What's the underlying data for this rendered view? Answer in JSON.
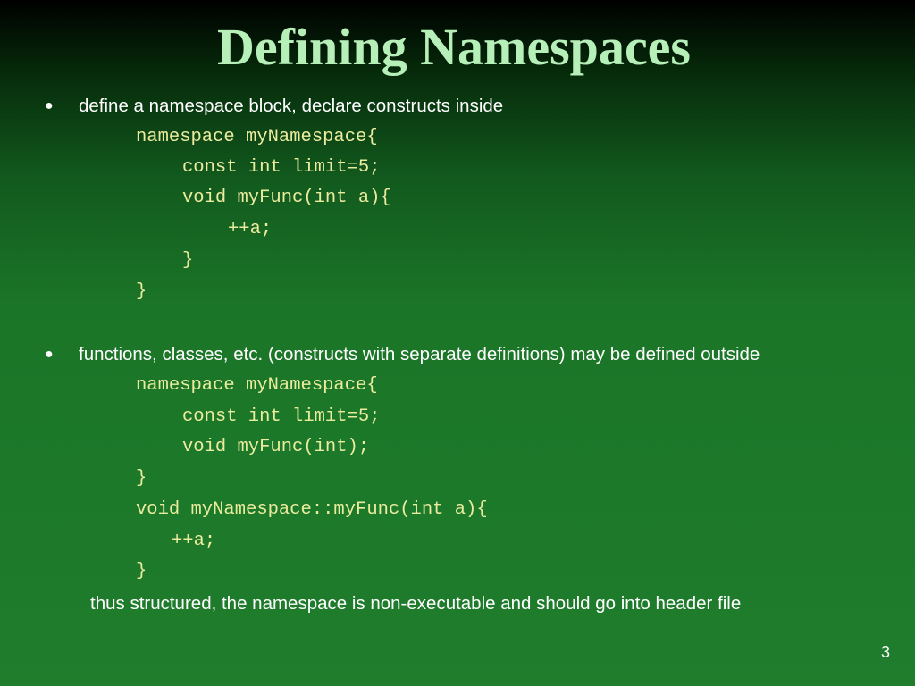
{
  "slide": {
    "title": "Defining Namespaces",
    "bullet_glyph": "●",
    "bullets": [
      {
        "text": "define a namespace block, declare constructs inside",
        "code": [
          "namespace myNamespace{",
          "const int limit=5;",
          "void myFunc(int a){",
          "++a;",
          "}",
          "}"
        ]
      },
      {
        "text": "functions, classes, etc. (constructs with separate definitions) may be defined outside",
        "code": [
          "namespace myNamespace{",
          "const int limit=5;",
          "void myFunc(int);",
          "}",
          "void myNamespace::myFunc(int a){",
          "++a;",
          "}"
        ]
      }
    ],
    "note": "thus structured, the namespace is non-executable and should go into header file",
    "page_number": "3"
  },
  "colors": {
    "title": "#b6f0b8",
    "code": "#ecec9e",
    "text": "#ffffff",
    "background_top": "#000000",
    "background_bottom": "#1f7d2c"
  }
}
